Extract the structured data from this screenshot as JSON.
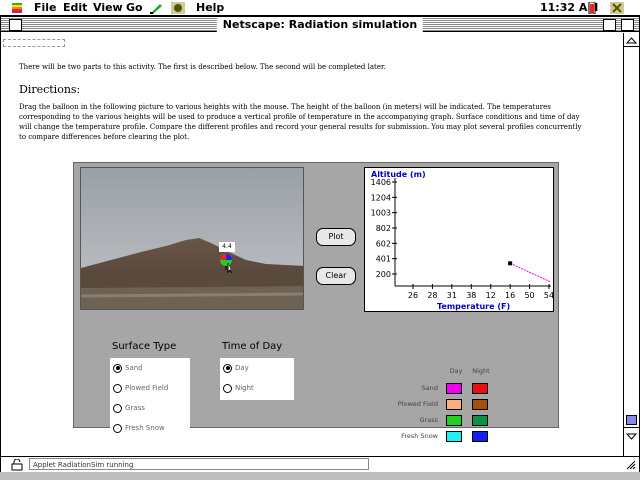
{
  "menubar": {
    "items": [
      "File",
      "Edit",
      "View",
      "Go",
      "Help"
    ],
    "time": "11:32 AM",
    "apple_icon": "apple-icon"
  },
  "window": {
    "title": "Netscape: Radiation simulation"
  },
  "page": {
    "intro": "There will be two parts to this activity. The first is described below. The second will be completed later.",
    "directions_heading": "Directions:",
    "directions_line1": "Drag the balloon in the following picture to various heights with the mouse. The height of the balloon (in meters) will be indicated. The temperatures",
    "directions_line2": "corresponding to the various heights will be used to produce a vertical profile of temperature in the accompanying graph. Surface conditions and time of day",
    "directions_line3": "will change the temperature profile. Compare the different profiles and record your general results for submission. You may plot several profiles concurrently",
    "directions_line4": "to compare differences before clearing the plot."
  },
  "applet": {
    "balloon_height": "4.4",
    "plot_button": "Plot",
    "clear_button": "Clear",
    "surface_type_heading": "Surface Type",
    "time_of_day_heading": "Time of Day",
    "surface_options": [
      "Sand",
      "Plowed Field",
      "Grass",
      "Fresh Snow"
    ],
    "surface_selected": "Sand",
    "time_options": [
      "Day",
      "Night"
    ],
    "time_selected": "Day",
    "legend": {
      "day_label": "Day",
      "night_label": "Night",
      "rows": [
        {
          "label": "Sand",
          "day": "#f000f0",
          "night": "#e81010"
        },
        {
          "label": "Plowed Field",
          "day": "#f8b080",
          "night": "#a05010"
        },
        {
          "label": "Grass",
          "day": "#20d020",
          "night": "#109040"
        },
        {
          "label": "Fresh Snow",
          "day": "#20f0f0",
          "night": "#1020f0"
        }
      ]
    }
  },
  "chart_data": {
    "type": "scatter",
    "ylabel": "Altitude (m)",
    "xlabel": "Temperature (F)",
    "x_ticks": [
      "26",
      "28",
      "31",
      "38",
      "12",
      "16",
      "50",
      "54"
    ],
    "y_ticks": [
      "1406",
      "1204",
      "1003",
      "802",
      "602",
      "401",
      "200"
    ],
    "points": [
      {
        "x": "16",
        "y": 340
      }
    ],
    "trace_color": "#f000f0"
  },
  "status": {
    "text": "Applet RadiationSim running"
  }
}
